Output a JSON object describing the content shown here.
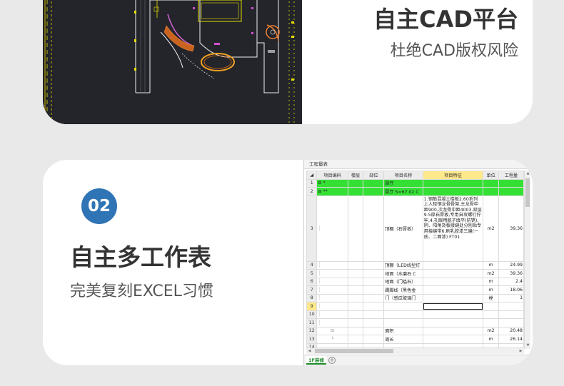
{
  "feature1": {
    "title": "自主CAD平台",
    "subtitle": "杜绝CAD版权风险"
  },
  "feature2": {
    "badge": "02",
    "title": "自主多工作表",
    "subtitle": "完美复刻EXCEL习惯"
  },
  "sheet": {
    "title": "工程量表",
    "collapse_icon": "«",
    "columns": [
      "",
      "项目编码",
      "楼层",
      "部位",
      "项目名称",
      "项目特征",
      "单位",
      "工程量"
    ],
    "rows": [
      {
        "n": "1",
        "code": "⊟ *",
        "name": "厨厅",
        "feature": "",
        "unit": "",
        "qty": ""
      },
      {
        "n": "2",
        "code": "⊟ **",
        "name": "厨厅 S=67.02 C",
        "feature": "",
        "unit": "",
        "qty": ""
      },
      {
        "n": "3",
        "code": "",
        "name": "顶棚（石膏板）",
        "feature": "1.钢筋混凝土楼板2.60系列上人轻钢龙骨骨架,主龙骨中距900,次龙骨中距4003.双层9.5厚石膏板,专用自攻螺钉拧牢,4.孔眼用腻子填平(防锈),阴、阳角及板接缝处分别贴专用接缝带6.刷乳胶漆三遍(一底、二面漆) FT01",
        "unit": "m2",
        "qty": "39.36"
      },
      {
        "n": "4",
        "code": "",
        "name": "顶棚（LED线型灯",
        "feature": "",
        "unit": "m",
        "qty": "24.99"
      },
      {
        "n": "5",
        "code": "",
        "name": "地面（水磨石 C",
        "feature": "",
        "unit": "m2",
        "qty": "39.36"
      },
      {
        "n": "6",
        "code": "",
        "name": "地面（门槛石）",
        "feature": "",
        "unit": "m",
        "qty": "2.4"
      },
      {
        "n": "7",
        "code": "",
        "name": "踢脚线（黑色金",
        "feature": "",
        "unit": "m",
        "qty": "18.06"
      },
      {
        "n": "8",
        "code": "",
        "name": "门（感应玻璃门",
        "feature": "",
        "unit": "樘",
        "qty": "1"
      },
      {
        "n": "9",
        "code": "",
        "name": "",
        "feature": "",
        "unit": "",
        "qty": ""
      },
      {
        "n": "10",
        "code": "",
        "name": "",
        "feature": "",
        "unit": "",
        "qty": ""
      },
      {
        "n": "11",
        "code": "",
        "name": "",
        "feature": "",
        "unit": "",
        "qty": ""
      },
      {
        "n": "12",
        "code": "⊟",
        "name": "面积",
        "feature": "",
        "unit": "m2",
        "qty": "20.48"
      },
      {
        "n": "13",
        "code": "",
        "name": "周长",
        "feature": "",
        "unit": "m",
        "qty": "26.14"
      },
      {
        "n": "14",
        "code": "",
        "name": "",
        "feature": "",
        "unit": "",
        "qty": ""
      }
    ],
    "tab_label": "1F装修",
    "add_tab_label": "+"
  },
  "colors": {
    "accent": "#2f74b5",
    "green_row": "#35e035",
    "tab_green": "#1e8b2d",
    "header_highlight": "#ffe98a",
    "cad_bg": "#23252b"
  }
}
